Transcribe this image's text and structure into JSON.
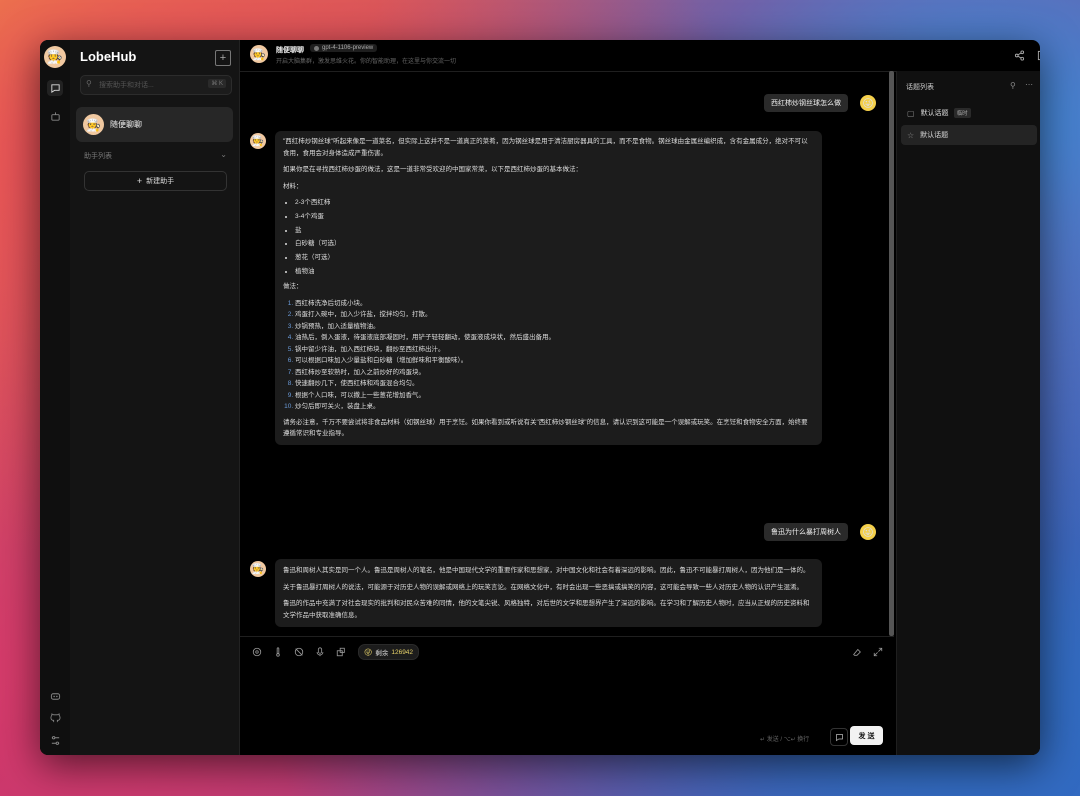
{
  "app": {
    "brand": "LobeHub"
  },
  "search": {
    "placeholder": "搜索助手和对话...",
    "shortcut": "⌘ K"
  },
  "sidebar": {
    "chat_item": "随便聊聊",
    "section_label": "助手列表",
    "add_label": "新建助手"
  },
  "header": {
    "title": "随便聊聊",
    "model": "gpt-4-1106-preview",
    "subtitle": "开启大脑集群，激发思维火花。你的智能助理，在这里与你交流一切"
  },
  "messages": {
    "user1": "西红柿炒钢丝球怎么做",
    "bot1": {
      "p1": "\"西红柿炒钢丝球\"听起来像是一道菜名，但实际上这并不是一道真正的菜肴，因为钢丝球是用于清洁厨房器具的工具，而不是食物。钢丝球由金属丝编织成，含有金属成分，绝对不可以食用，食用会对身体造成严重伤害。",
      "p2": "如果你是在寻找西红柿炒蛋的做法，这是一道非常受欢迎的中国家常菜，以下是西红柿炒蛋的基本做法：",
      "materials_label": "材料：",
      "materials": [
        "2-3个西红柿",
        "3-4个鸡蛋",
        "盐",
        "白砂糖（可选）",
        "葱花（可选）",
        "植物油"
      ],
      "steps_label": "做法：",
      "steps": [
        "西红柿洗净后切成小块。",
        "鸡蛋打入碗中，加入少许盐，搅拌均匀，打散。",
        "炒锅预热，加入适量植物油。",
        "油热后，倒入蛋液，待蛋液底部凝固时，用铲子轻轻翻动，使蛋液成块状，然后盛出备用。",
        "锅中留少许油，加入西红柿块，翻炒至西红柿出汁。",
        "可以根据口味加入少量盐和白砂糖（增加鲜味和平衡酸味）。",
        "西红柿炒至软熟时，加入之前炒好的鸡蛋块。",
        "快速翻炒几下，使西红柿和鸡蛋混合均匀。",
        "根据个人口味，可以撒上一些葱花增加香气。",
        "炒匀后即可关火，装盘上桌。"
      ],
      "p3": "请务必注意，千万不要尝试将非食品材料（如钢丝球）用于烹饪。如果你看到或听说有关\"西红柿炒钢丝球\"的信息，请认识到这可能是一个误解或玩笑。在烹饪和食物安全方面，始终要遵循常识和专业指导。"
    },
    "user2": "鲁迅为什么暴打周树人",
    "bot2": {
      "p1": "鲁迅和周树人其实是同一个人。鲁迅是周树人的笔名，他是中国现代文学的重要作家和思想家，对中国文化和社会有着深远的影响。因此，鲁迅不可能暴打周树人，因为他们是一体的。",
      "p2": "关于鲁迅暴打周树人的说法，可能源于对历史人物的误解或网络上的玩笑言论。在网络文化中，有时会出现一些恶搞或搞笑的内容，这可能会导致一些人对历史人物的认识产生混淆。",
      "p3": "鲁迅的作品中充满了对社会现实的批判和对民众苦难的同情，他的文笔尖锐、风格独特，对后世的文学和思想界产生了深远的影响。在学习和了解历史人物时，应当从正规的历史资料和文学作品中获取准确信息。"
    }
  },
  "input": {
    "tokens_label": "剩余",
    "tokens_value": "126942",
    "hint": "↵ 发送 / ⌥↵ 换行",
    "send_label": "发 送"
  },
  "topics": {
    "title": "话题列表",
    "items": [
      {
        "label": "默认话题",
        "badge": "临时"
      },
      {
        "label": "默认话题"
      }
    ]
  },
  "colors": {
    "accent": "#f2f2f2",
    "token_text": "#e8d36a",
    "list_marker": "#6a9ad8"
  }
}
